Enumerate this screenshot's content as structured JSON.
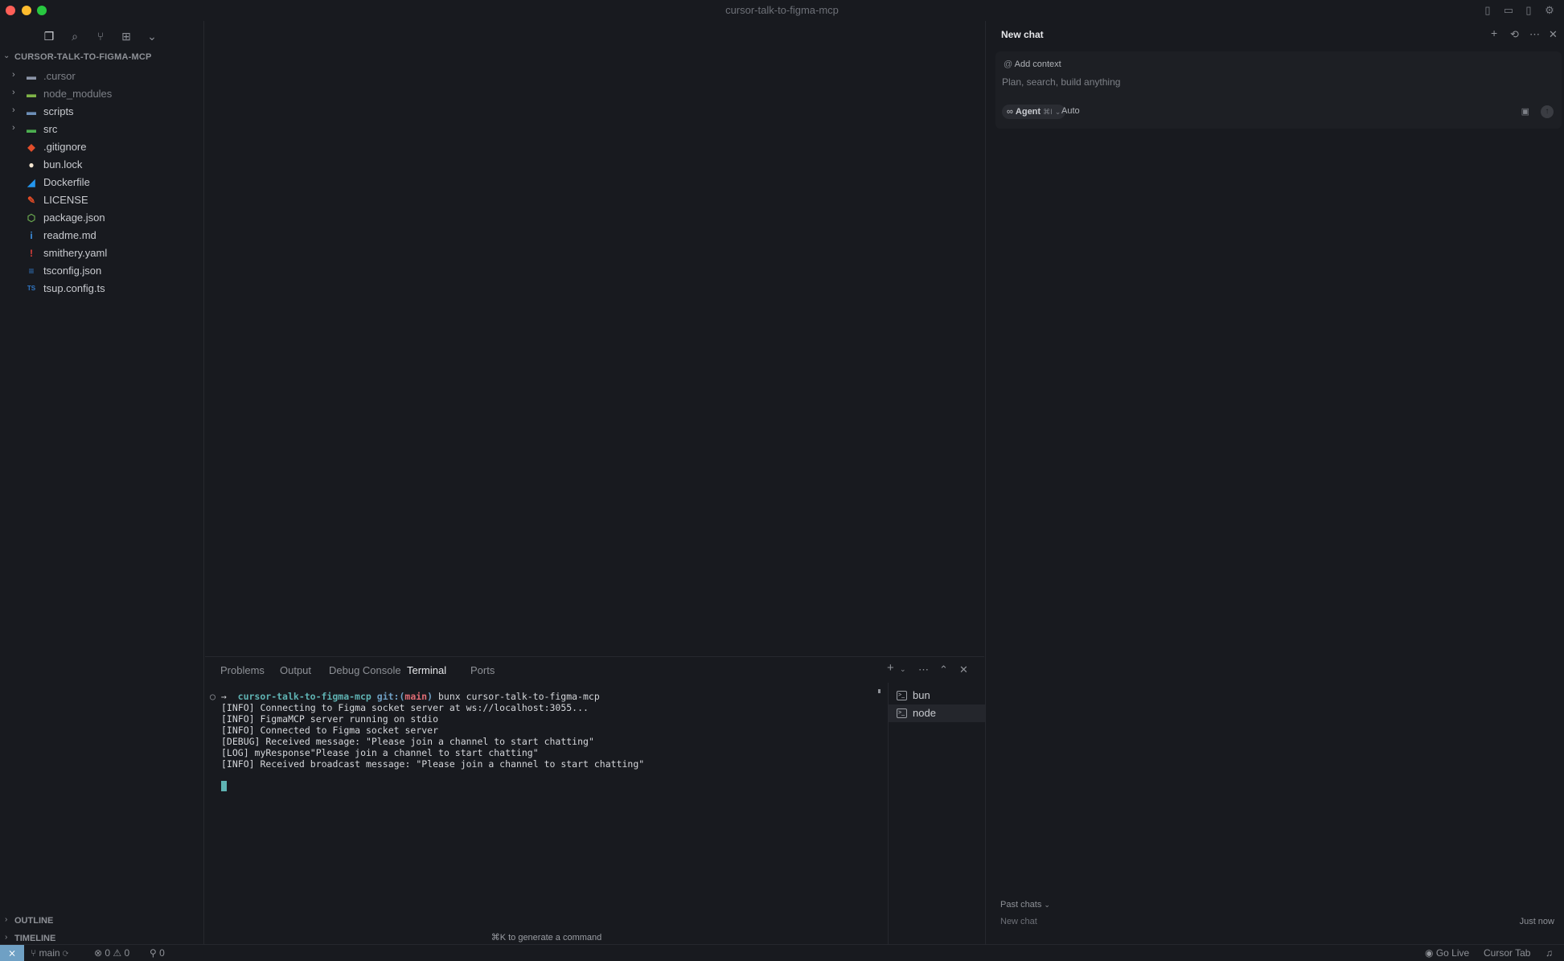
{
  "window": {
    "title": "cursor-talk-to-figma-mcp"
  },
  "traffic_colors": {
    "close": "#ff5f57",
    "minimize": "#febc2e",
    "zoom": "#28c840"
  },
  "explorer": {
    "root": "CURSOR-TALK-TO-FIGMA-MCP",
    "items": [
      {
        "label": ".cursor",
        "folder": true,
        "dim": true,
        "icon": "folder-icon"
      },
      {
        "label": "node_modules",
        "folder": true,
        "dim": true,
        "icon": "node-folder-icon"
      },
      {
        "label": "scripts",
        "folder": true,
        "dim": false,
        "icon": "scripts-folder-icon"
      },
      {
        "label": "src",
        "folder": true,
        "dim": false,
        "icon": "src-folder-icon"
      },
      {
        "label": ".gitignore",
        "folder": false,
        "dim": false,
        "icon": "git-icon"
      },
      {
        "label": "bun.lock",
        "folder": false,
        "dim": false,
        "icon": "bun-icon"
      },
      {
        "label": "Dockerfile",
        "folder": false,
        "dim": false,
        "icon": "docker-icon"
      },
      {
        "label": "LICENSE",
        "folder": false,
        "dim": false,
        "icon": "license-icon"
      },
      {
        "label": "package.json",
        "folder": false,
        "dim": false,
        "icon": "nodejs-icon"
      },
      {
        "label": "readme.md",
        "folder": false,
        "dim": false,
        "icon": "info-icon"
      },
      {
        "label": "smithery.yaml",
        "folder": false,
        "dim": false,
        "icon": "yaml-icon"
      },
      {
        "label": "tsconfig.json",
        "folder": false,
        "dim": false,
        "icon": "tsconfig-icon"
      },
      {
        "label": "tsup.config.ts",
        "folder": false,
        "dim": false,
        "icon": "typescript-icon"
      }
    ],
    "outline": "OUTLINE",
    "timeline": "TIMELINE"
  },
  "panel": {
    "tabs": [
      "Problems",
      "Output",
      "Debug Console",
      "Terminal",
      "Ports"
    ],
    "active_tab": "Terminal",
    "prompt": {
      "arrow": "→",
      "dir": "cursor-talk-to-figma-mcp",
      "git_prefix": "git:(",
      "branch": "main",
      "git_suffix": ")",
      "command": "bunx cursor-talk-to-figma-mcp"
    },
    "lines": [
      "[INFO] Connecting to Figma socket server at ws://localhost:3055...",
      "[INFO] FigmaMCP server running on stdio",
      "[INFO] Connected to Figma socket server",
      "[DEBUG] Received message: \"Please join a channel to start chatting\"",
      "[LOG] myResponse\"Please join a channel to start chatting\"",
      "[INFO] Received broadcast message: \"Please join a channel to start chatting\""
    ],
    "terminals": [
      "bun",
      "node"
    ],
    "active_terminal": "node",
    "hint": "⌘K to generate a command"
  },
  "chat": {
    "title": "New chat",
    "add_context": "Add context",
    "placeholder": "Plan, search, build anything",
    "agent": "Agent",
    "agent_shortcut": "⌘I",
    "model": "Auto",
    "past_chats": "Past chats",
    "past_item": "New chat",
    "past_time": "Just now"
  },
  "status": {
    "branch": "main",
    "errors": "0",
    "warnings": "0",
    "ports": "0",
    "go_live": "Go Live",
    "cursor_tab": "Cursor Tab"
  },
  "colors": {
    "accent": "#6fa0c4",
    "prompt_dir": "#5fb3b3",
    "branch": "#e06c75"
  }
}
